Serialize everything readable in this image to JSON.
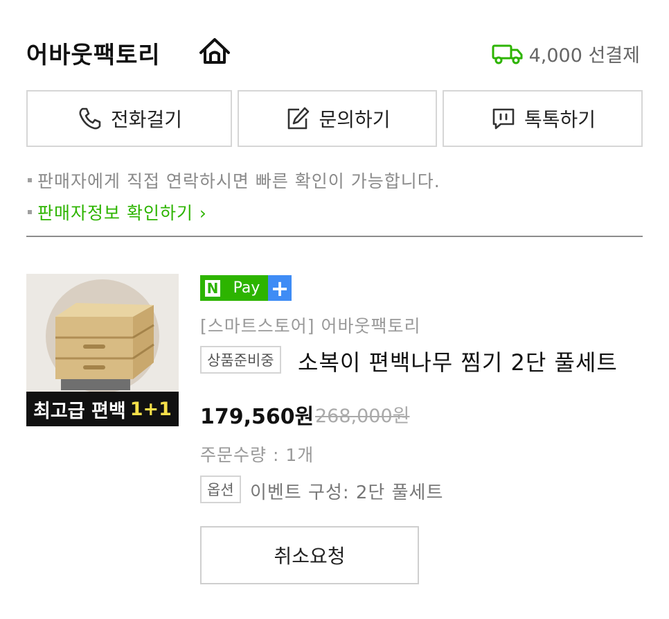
{
  "seller": {
    "name": "어바웃팩토리",
    "home_icon": "home-icon",
    "shipping_icon": "truck-icon",
    "shipping_fee": "4,000 선결제"
  },
  "contact_buttons": [
    {
      "label": "전화걸기",
      "icon": "phone-icon"
    },
    {
      "label": "문의하기",
      "icon": "edit-icon"
    },
    {
      "label": "톡톡하기",
      "icon": "chat-icon"
    }
  ],
  "notes": {
    "direct_contact": "판매자에게 직접 연락하시면 빠른 확인이 가능합니다.",
    "seller_info_link": "판매자정보 확인하기 ›"
  },
  "product": {
    "thumbnail_caption": "최고급 편백",
    "thumbnail_promo": "1+1",
    "npay": {
      "n": "N",
      "pay": "Pay",
      "plus": "+"
    },
    "store_line": "[스마트스토어] 어바웃팩토리",
    "status": "상품준비중",
    "title": "소복이 편백나무 찜기 2단 풀세트",
    "price": "179,560원",
    "original_price": "268,000원",
    "quantity": "주문수량 : 1개",
    "option_label": "옵션",
    "option_value": "이벤트 구성: 2단 풀세트",
    "cancel_button": "취소요청"
  },
  "colors": {
    "brand_green": "#2db400",
    "npay_plus_blue": "#3f8cf5",
    "promo_yellow": "#f6e04a"
  }
}
